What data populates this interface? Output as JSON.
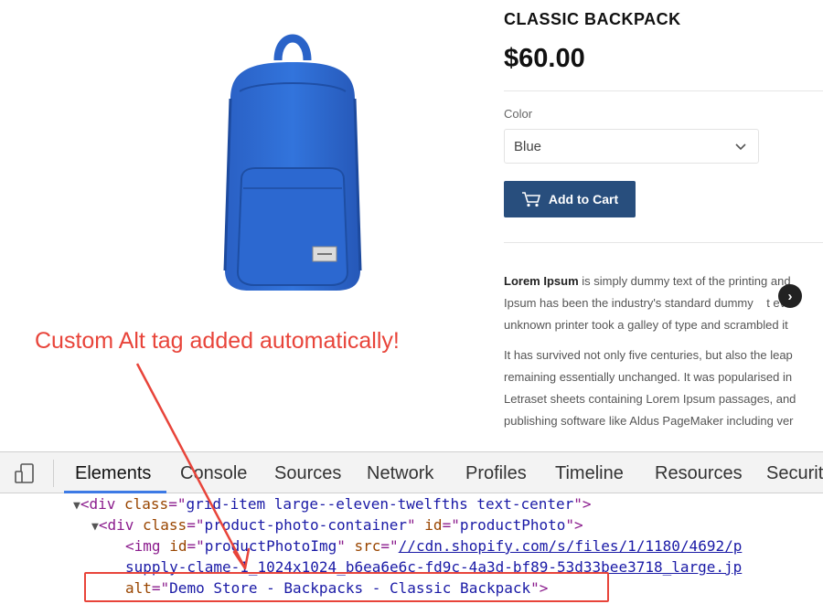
{
  "product": {
    "title": "CLASSIC BACKPACK",
    "price": "$60.00",
    "color_label": "Color",
    "color_value": "Blue",
    "add_to_cart": "Add to Cart",
    "desc1": {
      "bold": "Lorem Ipsum",
      "line1": " is simply dummy text of the printing and",
      "line2": "Ipsum has been the industry's standard dummy",
      "line2b": "t ev",
      "line3": "unknown printer took a galley of type and scrambled it"
    },
    "desc2": {
      "line1": "It has survived not only five centuries, but also the leap",
      "line2": "remaining essentially unchanged. It was popularised in",
      "line3": "Letraset sheets containing Lorem Ipsum passages, and",
      "line4": "publishing software like Aldus PageMaker including ver"
    },
    "next_arrow": "›"
  },
  "annotation": {
    "text": "Custom Alt tag added automatically!"
  },
  "devtools": {
    "tabs": [
      "Elements",
      "Console",
      "Sources",
      "Network",
      "Profiles",
      "Timeline",
      "Resources",
      "Securit"
    ],
    "active_tab": "Elements",
    "lines": {
      "l1": {
        "tag": "div",
        "attr": "class",
        "value": "grid-item large--eleven-twelfths text-center"
      },
      "l2": {
        "tag": "div",
        "attr1": "class",
        "value1": "product-photo-container",
        "attr2": "id",
        "value2": "productPhoto"
      },
      "l3": {
        "tag": "img",
        "attr1": "id",
        "value1": "productPhotoImg",
        "attr2": "src",
        "value2": "//cdn.shopify.com/s/files/1/1180/4692/p"
      },
      "l4": {
        "value": "supply-clame-1_1024x1024_b6ea6e6c-fd9c-4a3d-bf89-53d33bee3718_large.jp"
      },
      "l5": {
        "attr": "alt",
        "value": "Demo Store - Backpacks - Classic Backpack"
      }
    }
  },
  "colors": {
    "button": "#284e7d",
    "annotation": "#e8443a",
    "backpack": "#2f6fd6",
    "devtools_active": "#3d7ae5"
  },
  "icons": [
    "backpack-image",
    "chevron-down-icon",
    "cart-icon",
    "next-arrow-icon",
    "device-toggle-icon"
  ]
}
